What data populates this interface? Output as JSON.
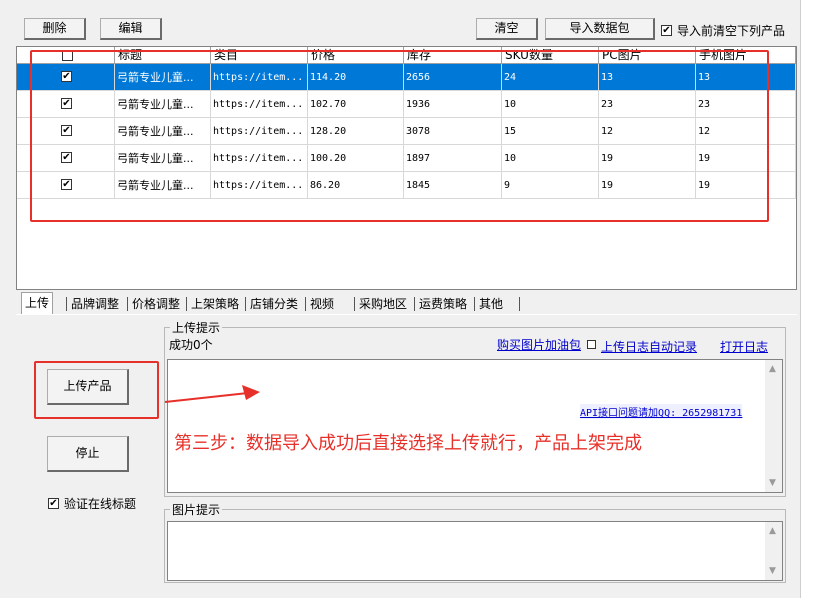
{
  "toolbar": {
    "delete_label": "删除",
    "edit_label": "编辑",
    "clear_label": "清空",
    "import_label": "导入数据包",
    "clear_before_import_label": "导入前清空下列产品",
    "clear_before_import_checked": "✔"
  },
  "grid": {
    "columns": [
      "标题",
      "类目",
      "价格",
      "库存",
      "SKU数量",
      "PC图片",
      "手机图片"
    ],
    "rows": [
      {
        "checked": "✔",
        "title": "弓箭专业儿童...",
        "category": "https://item...",
        "price": "114.20",
        "stock": "2656",
        "sku": "24",
        "pc": "13",
        "mobile": "13"
      },
      {
        "checked": "✔",
        "title": "弓箭专业儿童...",
        "category": "https://item...",
        "price": "102.70",
        "stock": "1936",
        "sku": "10",
        "pc": "23",
        "mobile": "23"
      },
      {
        "checked": "✔",
        "title": "弓箭专业儿童...",
        "category": "https://item...",
        "price": "128.20",
        "stock": "3078",
        "sku": "15",
        "pc": "12",
        "mobile": "12"
      },
      {
        "checked": "✔",
        "title": "弓箭专业儿童...",
        "category": "https://item...",
        "price": "100.20",
        "stock": "1897",
        "sku": "10",
        "pc": "19",
        "mobile": "19"
      },
      {
        "checked": "✔",
        "title": "弓箭专业儿童...",
        "category": "https://item...",
        "price": "86.20",
        "stock": "1845",
        "sku": "9",
        "pc": "19",
        "mobile": "19"
      }
    ]
  },
  "tabs": [
    "上传",
    "品牌调整",
    "价格调整",
    "上架策略",
    "店铺分类",
    "视频",
    "采购地区",
    "运费策略",
    "其他"
  ],
  "upload": {
    "upload_button": "上传产品",
    "stop_button": "停止",
    "verify_online_title_label": "验证在线标题",
    "verify_online_title_checked": "✔",
    "hint_group_title": "上传提示",
    "success_text": "成功0个",
    "buy_traffic_link": "购买图片加油包",
    "auto_log_label": "上传日志自动记录",
    "open_log_link": "打开日志",
    "api_qq_text": "API接口问题请加QQ: 2652981731",
    "image_hint_title": "图片提示"
  },
  "annotation": {
    "step_text": "第三步：数据导入成功后直接选择上传就行，产品上架完成",
    "color": "#e8302a"
  },
  "colors": {
    "selected_row": "#0078d7",
    "link": "#0000cc",
    "annotation_red": "#e8302a"
  }
}
